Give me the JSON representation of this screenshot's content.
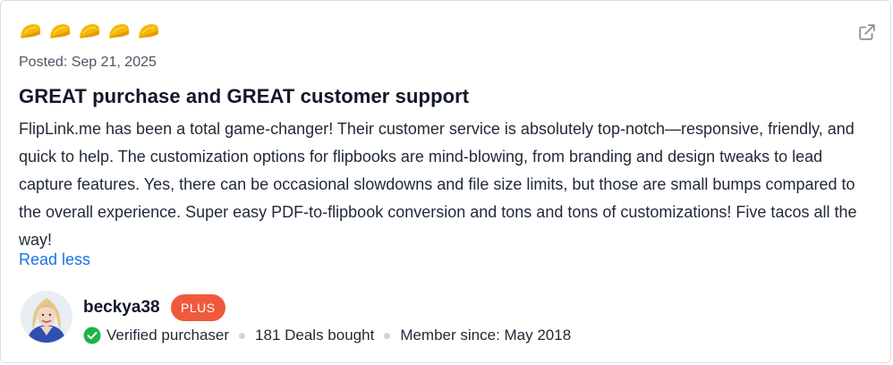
{
  "review": {
    "rating": 5,
    "rating_icon": "taco-icon",
    "rating_color": "#f5b800",
    "posted": "Posted: Sep 21, 2025",
    "title": "GREAT purchase and GREAT customer support",
    "body": "FlipLink.me has been a total game-changer! Their customer service is absolutely top-notch—responsive, friendly, and quick to help. The customization options for flipbooks are mind-blowing, from branding and design tweaks to lead capture features. Yes, there can be occasional slowdowns and file size limits, but those are small bumps compared to the overall experience. Super easy PDF-to-flipbook conversion and tons and tons of customizations! Five tacos all the way!",
    "read_less": "Read less",
    "external_link_icon": "external-link-icon"
  },
  "reviewer": {
    "username": "beckya38",
    "badge": "PLUS",
    "badge_color": "#ef5a3c",
    "verified": "Verified purchaser",
    "verified_color": "#22b24c",
    "deals": "181 Deals bought",
    "member_since": "Member since: May 2018"
  },
  "colors": {
    "link": "#1a73e8"
  }
}
